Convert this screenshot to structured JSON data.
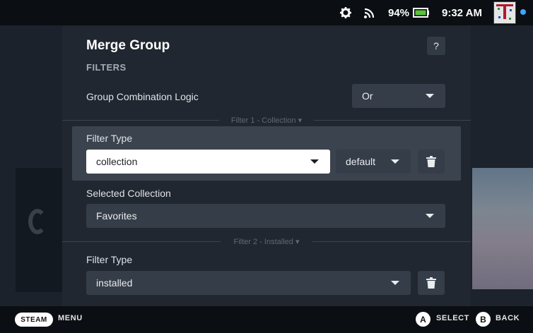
{
  "status_bar": {
    "battery_percent": "94%",
    "time": "9:32 AM",
    "icons": [
      "settings-gear-icon",
      "wifi-icon",
      "battery-icon",
      "avatar",
      "notification-dot"
    ]
  },
  "modal": {
    "title": "Merge Group",
    "help_label": "?",
    "section_header": "FILTERS",
    "combination_logic": {
      "label": "Group Combination Logic",
      "value": "Or"
    },
    "filters": [
      {
        "divider_label": "Filter 1 - Collection",
        "filter_type_label": "Filter Type",
        "filter_type_value": "collection",
        "mode_value": "default",
        "selected_label": "Selected Collection",
        "selected_value": "Favorites"
      },
      {
        "divider_label": "Filter 2 - Installed",
        "filter_type_label": "Filter Type",
        "filter_type_value": "installed"
      }
    ]
  },
  "footer": {
    "steam_label": "STEAM",
    "menu_label": "MENU",
    "a_button": "A",
    "select_label": "SELECT",
    "b_button": "B",
    "back_label": "BACK"
  },
  "colors": {
    "modal_bg": "#202730",
    "highlight_bg": "#3b434e",
    "dropdown_bg": "#353d48",
    "battery_green": "#5ac33c"
  }
}
